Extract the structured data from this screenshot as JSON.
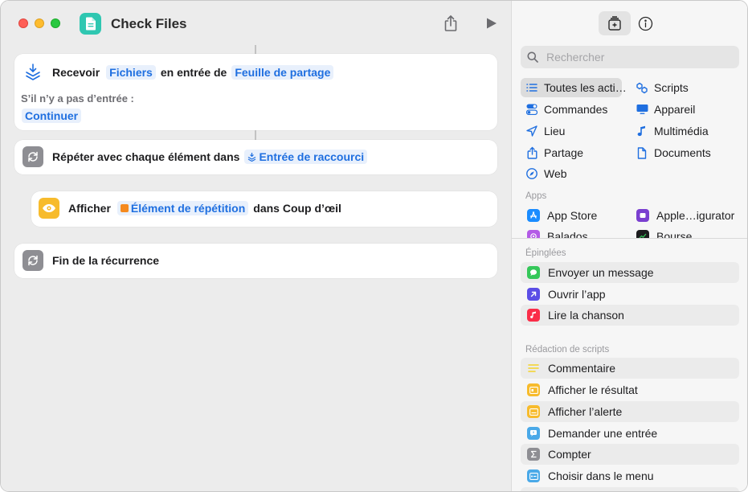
{
  "window": {
    "title": "Check Files"
  },
  "workflow": {
    "receive": {
      "verb": "Recevoir",
      "type_pill": "Fichiers",
      "middle": "en entrée de",
      "source_pill": "Feuille de partage",
      "no_input_label": "S’il n’y a pas d’entrée :",
      "no_input_pill": "Continuer"
    },
    "repeat": {
      "text": "Répéter avec chaque élément dans",
      "pill": "Entrée de raccourci"
    },
    "show": {
      "verb": "Afficher",
      "pill": "Élément de répétition",
      "suffix": "dans Coup d’œil"
    },
    "end": {
      "text": "Fin de la récurrence"
    }
  },
  "sidebar": {
    "search_placeholder": "Rechercher",
    "categories": [
      {
        "label": "Toutes les acti…",
        "icon": "list-icon",
        "selected": true
      },
      {
        "label": "Scripts",
        "icon": "scripts-icon"
      },
      {
        "label": "Commandes",
        "icon": "toggles-icon"
      },
      {
        "label": "Appareil",
        "icon": "display-icon"
      },
      {
        "label": "Lieu",
        "icon": "location-arrow-icon"
      },
      {
        "label": "Multimédia",
        "icon": "music-note-icon"
      },
      {
        "label": "Partage",
        "icon": "share-icon"
      },
      {
        "label": "Documents",
        "icon": "document-icon"
      },
      {
        "label": "Web",
        "icon": "compass-icon"
      }
    ],
    "apps_label": "Apps",
    "apps": [
      {
        "label": "App Store",
        "icon": "app-store-icon",
        "color": "#1a8cff"
      },
      {
        "label": "Apple…igurator",
        "icon": "apple-configurator-icon",
        "color": "#7a3fd0"
      },
      {
        "label": "Balados",
        "icon": "podcasts-icon",
        "color": "#b35be6"
      },
      {
        "label": "Bourse",
        "icon": "stocks-icon",
        "color": "#1c1c1e"
      }
    ],
    "pinned_label": "Épinglées",
    "pinned": [
      {
        "label": "Envoyer un message",
        "icon": "messages-icon",
        "color": "#34c759"
      },
      {
        "label": "Ouvrir l’app",
        "icon": "open-app-icon",
        "color": "#5b4ee6"
      },
      {
        "label": "Lire la chanson",
        "icon": "music-icon",
        "color": "#fa2d48"
      }
    ],
    "scripting_label": "Rédaction de scripts",
    "scripting": [
      {
        "label": "Commentaire",
        "icon": "comment-icon",
        "color": "#f5d328"
      },
      {
        "label": "Afficher le résultat",
        "icon": "show-result-icon",
        "color": "#f7bb2c"
      },
      {
        "label": "Afficher l’alerte",
        "icon": "show-alert-icon",
        "color": "#f7bb2c"
      },
      {
        "label": "Demander une entrée",
        "icon": "ask-input-icon",
        "color": "#4aa9e8"
      },
      {
        "label": "Compter",
        "icon": "count-icon",
        "color": "#8e8e93"
      },
      {
        "label": "Choisir dans le menu",
        "icon": "choose-menu-icon",
        "color": "#4aa9e8"
      }
    ]
  }
}
